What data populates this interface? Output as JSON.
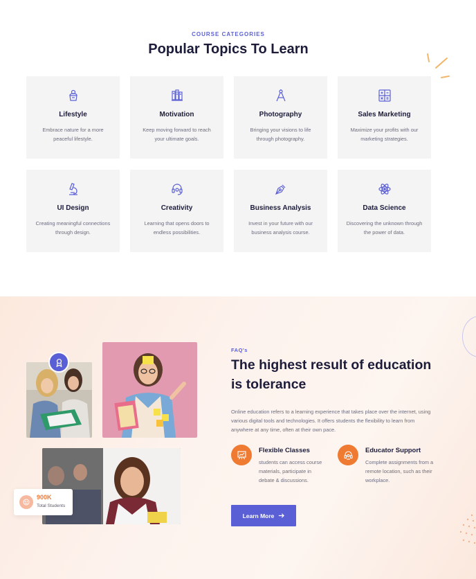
{
  "categories": {
    "eyebrow": "COURSE CATEGORIES",
    "title": "Popular Topics To Learn",
    "cards": [
      {
        "icon": "lifestyle-icon",
        "title": "Lifestyle",
        "desc": "Embrace nature for a more peaceful lifestyle."
      },
      {
        "icon": "books-icon",
        "title": "Motivation",
        "desc": "Keep moving forward to reach your ultimate goals."
      },
      {
        "icon": "compass-icon",
        "title": "Photography",
        "desc": "Bringing your visions to life through photography."
      },
      {
        "icon": "calculator-icon",
        "title": "Sales Marketing",
        "desc": "Maximize your profits with our marketing strategies."
      },
      {
        "icon": "microscope-icon",
        "title": "UI Design",
        "desc": "Creating meaningful connections through design."
      },
      {
        "icon": "headset-icon",
        "title": "Creativity",
        "desc": "Learning that opens doors to endless possibilities."
      },
      {
        "icon": "pen-nib-icon",
        "title": "Business Analysis",
        "desc": "Invest in your future with our business analysis course."
      },
      {
        "icon": "atom-icon",
        "title": "Data Science",
        "desc": "Discovering the unknown through the power of data."
      }
    ]
  },
  "faq": {
    "eyebrow": "FAQ's",
    "title": "The highest result of education is tolerance",
    "description": "Online education refers to a learning experience that takes place over the internet, using various digital tools and technologies. It offers students the flexibility to learn from anywhere at any time, often at their own pace.",
    "features": [
      {
        "icon": "whiteboard-icon",
        "title": "Flexible Classes",
        "desc": "students can access course materials, participate in debate & discussions."
      },
      {
        "icon": "support-icon",
        "title": "Educator Support",
        "desc": "Complete assignments from a remote location, such as their workplace."
      }
    ],
    "button_label": "Learn More",
    "stat": {
      "value": "900K",
      "label": "Total Students",
      "icon": "smile-icon"
    }
  },
  "colors": {
    "accent": "#5a5fd6",
    "orange": "#ef7a32",
    "heading": "#1c1c3a",
    "card_bg": "#f4f4f5"
  }
}
